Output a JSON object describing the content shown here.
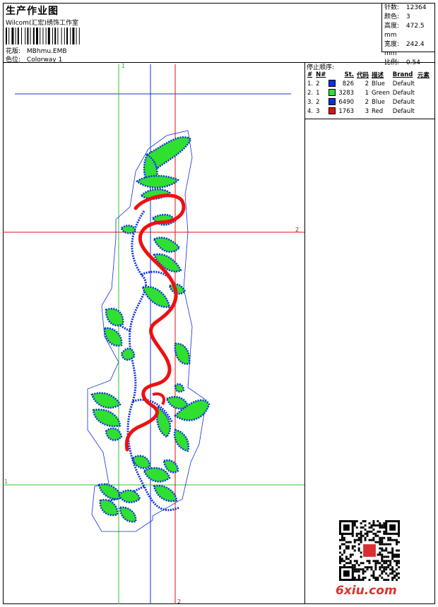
{
  "header": {
    "title": "生产作业图",
    "company": "Wilcom(汇宏)绣饰工作室",
    "design_label": "花版:",
    "design_value": "MBhmu.EMB",
    "colorway_label": "色位:",
    "colorway_value": "Colorway 1"
  },
  "stats": [
    {
      "label": "针数:",
      "value": "12364"
    },
    {
      "label": "颜色:",
      "value": "3"
    },
    {
      "label": "高度:",
      "value": "472.5 mm"
    },
    {
      "label": "宽度:",
      "value": "242.4 mm"
    },
    {
      "label": "比例:",
      "value": "0.54"
    }
  ],
  "stop_sequence": {
    "title": "停止顺序:",
    "headers": [
      "#",
      "N#",
      "St.",
      "代码",
      "描述",
      "Brand",
      "元素"
    ],
    "rows": [
      {
        "num": "1.",
        "needle": "2",
        "color": "#1030e0",
        "stitches": "826",
        "code": "2",
        "desc": "Blue",
        "brand": "Default"
      },
      {
        "num": "2.",
        "needle": "1",
        "color": "#30e030",
        "stitches": "3283",
        "code": "1",
        "desc": "Green",
        "brand": "Default"
      },
      {
        "num": "3.",
        "needle": "2",
        "color": "#1030e0",
        "stitches": "6490",
        "code": "2",
        "desc": "Blue",
        "brand": "Default"
      },
      {
        "num": "4.",
        "needle": "3",
        "color": "#e01010",
        "stitches": "1763",
        "code": "3",
        "desc": "Red",
        "brand": "Default"
      }
    ]
  },
  "guides": {
    "green_top_label": "1",
    "red_right_label": "2",
    "green_left_label": "1",
    "red_bottom_label": "2"
  },
  "colors": {
    "blue": "#1030e0",
    "green": "#30e030",
    "red": "#ee1010"
  },
  "watermark": "6xiu.com"
}
